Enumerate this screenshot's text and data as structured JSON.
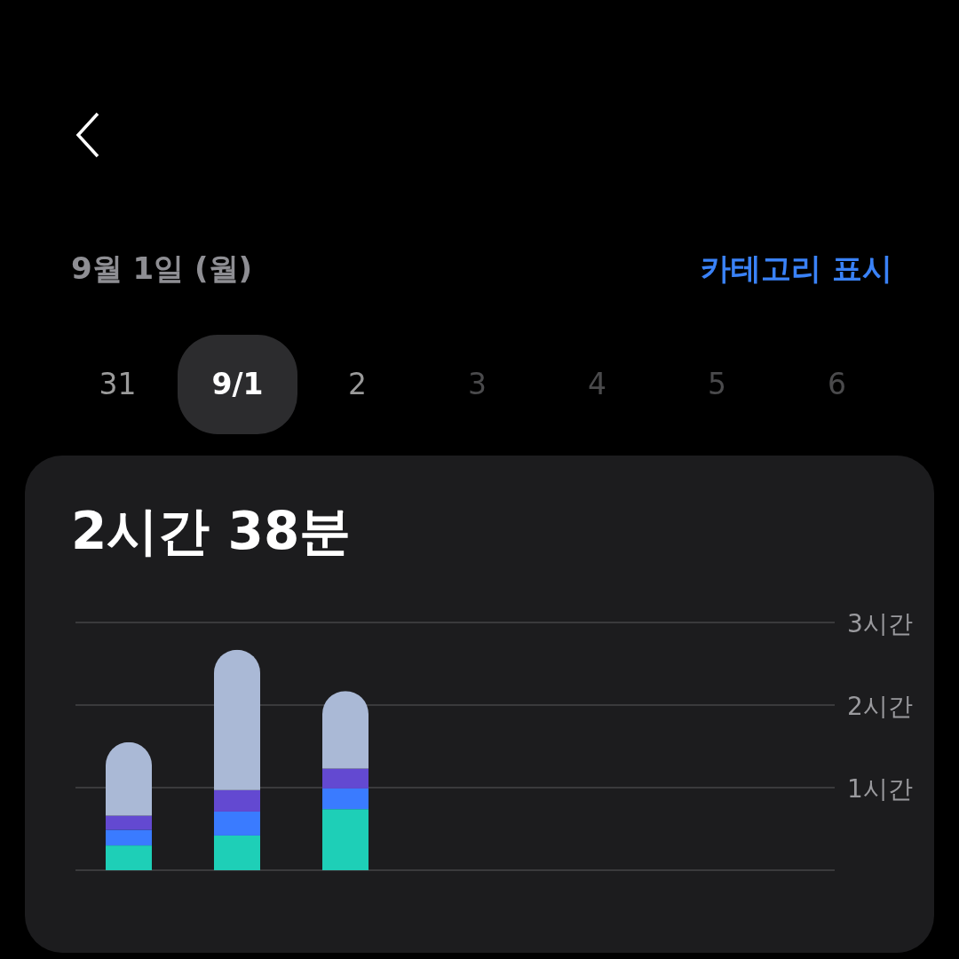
{
  "header": {
    "date_label": "9월 1일 (월)",
    "link": "카테고리 표시"
  },
  "days": [
    {
      "label": "31",
      "selected": false,
      "disabled": false
    },
    {
      "label": "9/1",
      "selected": true,
      "disabled": false
    },
    {
      "label": "2",
      "selected": false,
      "disabled": false
    },
    {
      "label": "3",
      "selected": false,
      "disabled": true
    },
    {
      "label": "4",
      "selected": false,
      "disabled": true
    },
    {
      "label": "5",
      "selected": false,
      "disabled": true
    },
    {
      "label": "6",
      "selected": false,
      "disabled": true
    }
  ],
  "summary": {
    "total": "2시간 38분"
  },
  "chart_data": {
    "type": "bar",
    "stacked": true,
    "ylim": [
      0,
      3
    ],
    "yticks": [
      {
        "value": 1,
        "label": "1시간"
      },
      {
        "value": 2,
        "label": "2시간"
      },
      {
        "value": 3,
        "label": "3시간"
      }
    ],
    "series": [
      {
        "color": "#1ecfb7",
        "values": [
          0.3,
          0.42,
          0.74,
          null,
          null,
          null,
          null
        ]
      },
      {
        "color": "#3a7bff",
        "values": [
          0.19,
          0.29,
          0.25,
          null,
          null,
          null,
          null
        ]
      },
      {
        "color": "#6349d1",
        "values": [
          0.17,
          0.26,
          0.24,
          null,
          null,
          null,
          null
        ]
      },
      {
        "color": "#aab9d6",
        "values": [
          0.89,
          1.7,
          0.94,
          null,
          null,
          null,
          null
        ]
      }
    ]
  }
}
